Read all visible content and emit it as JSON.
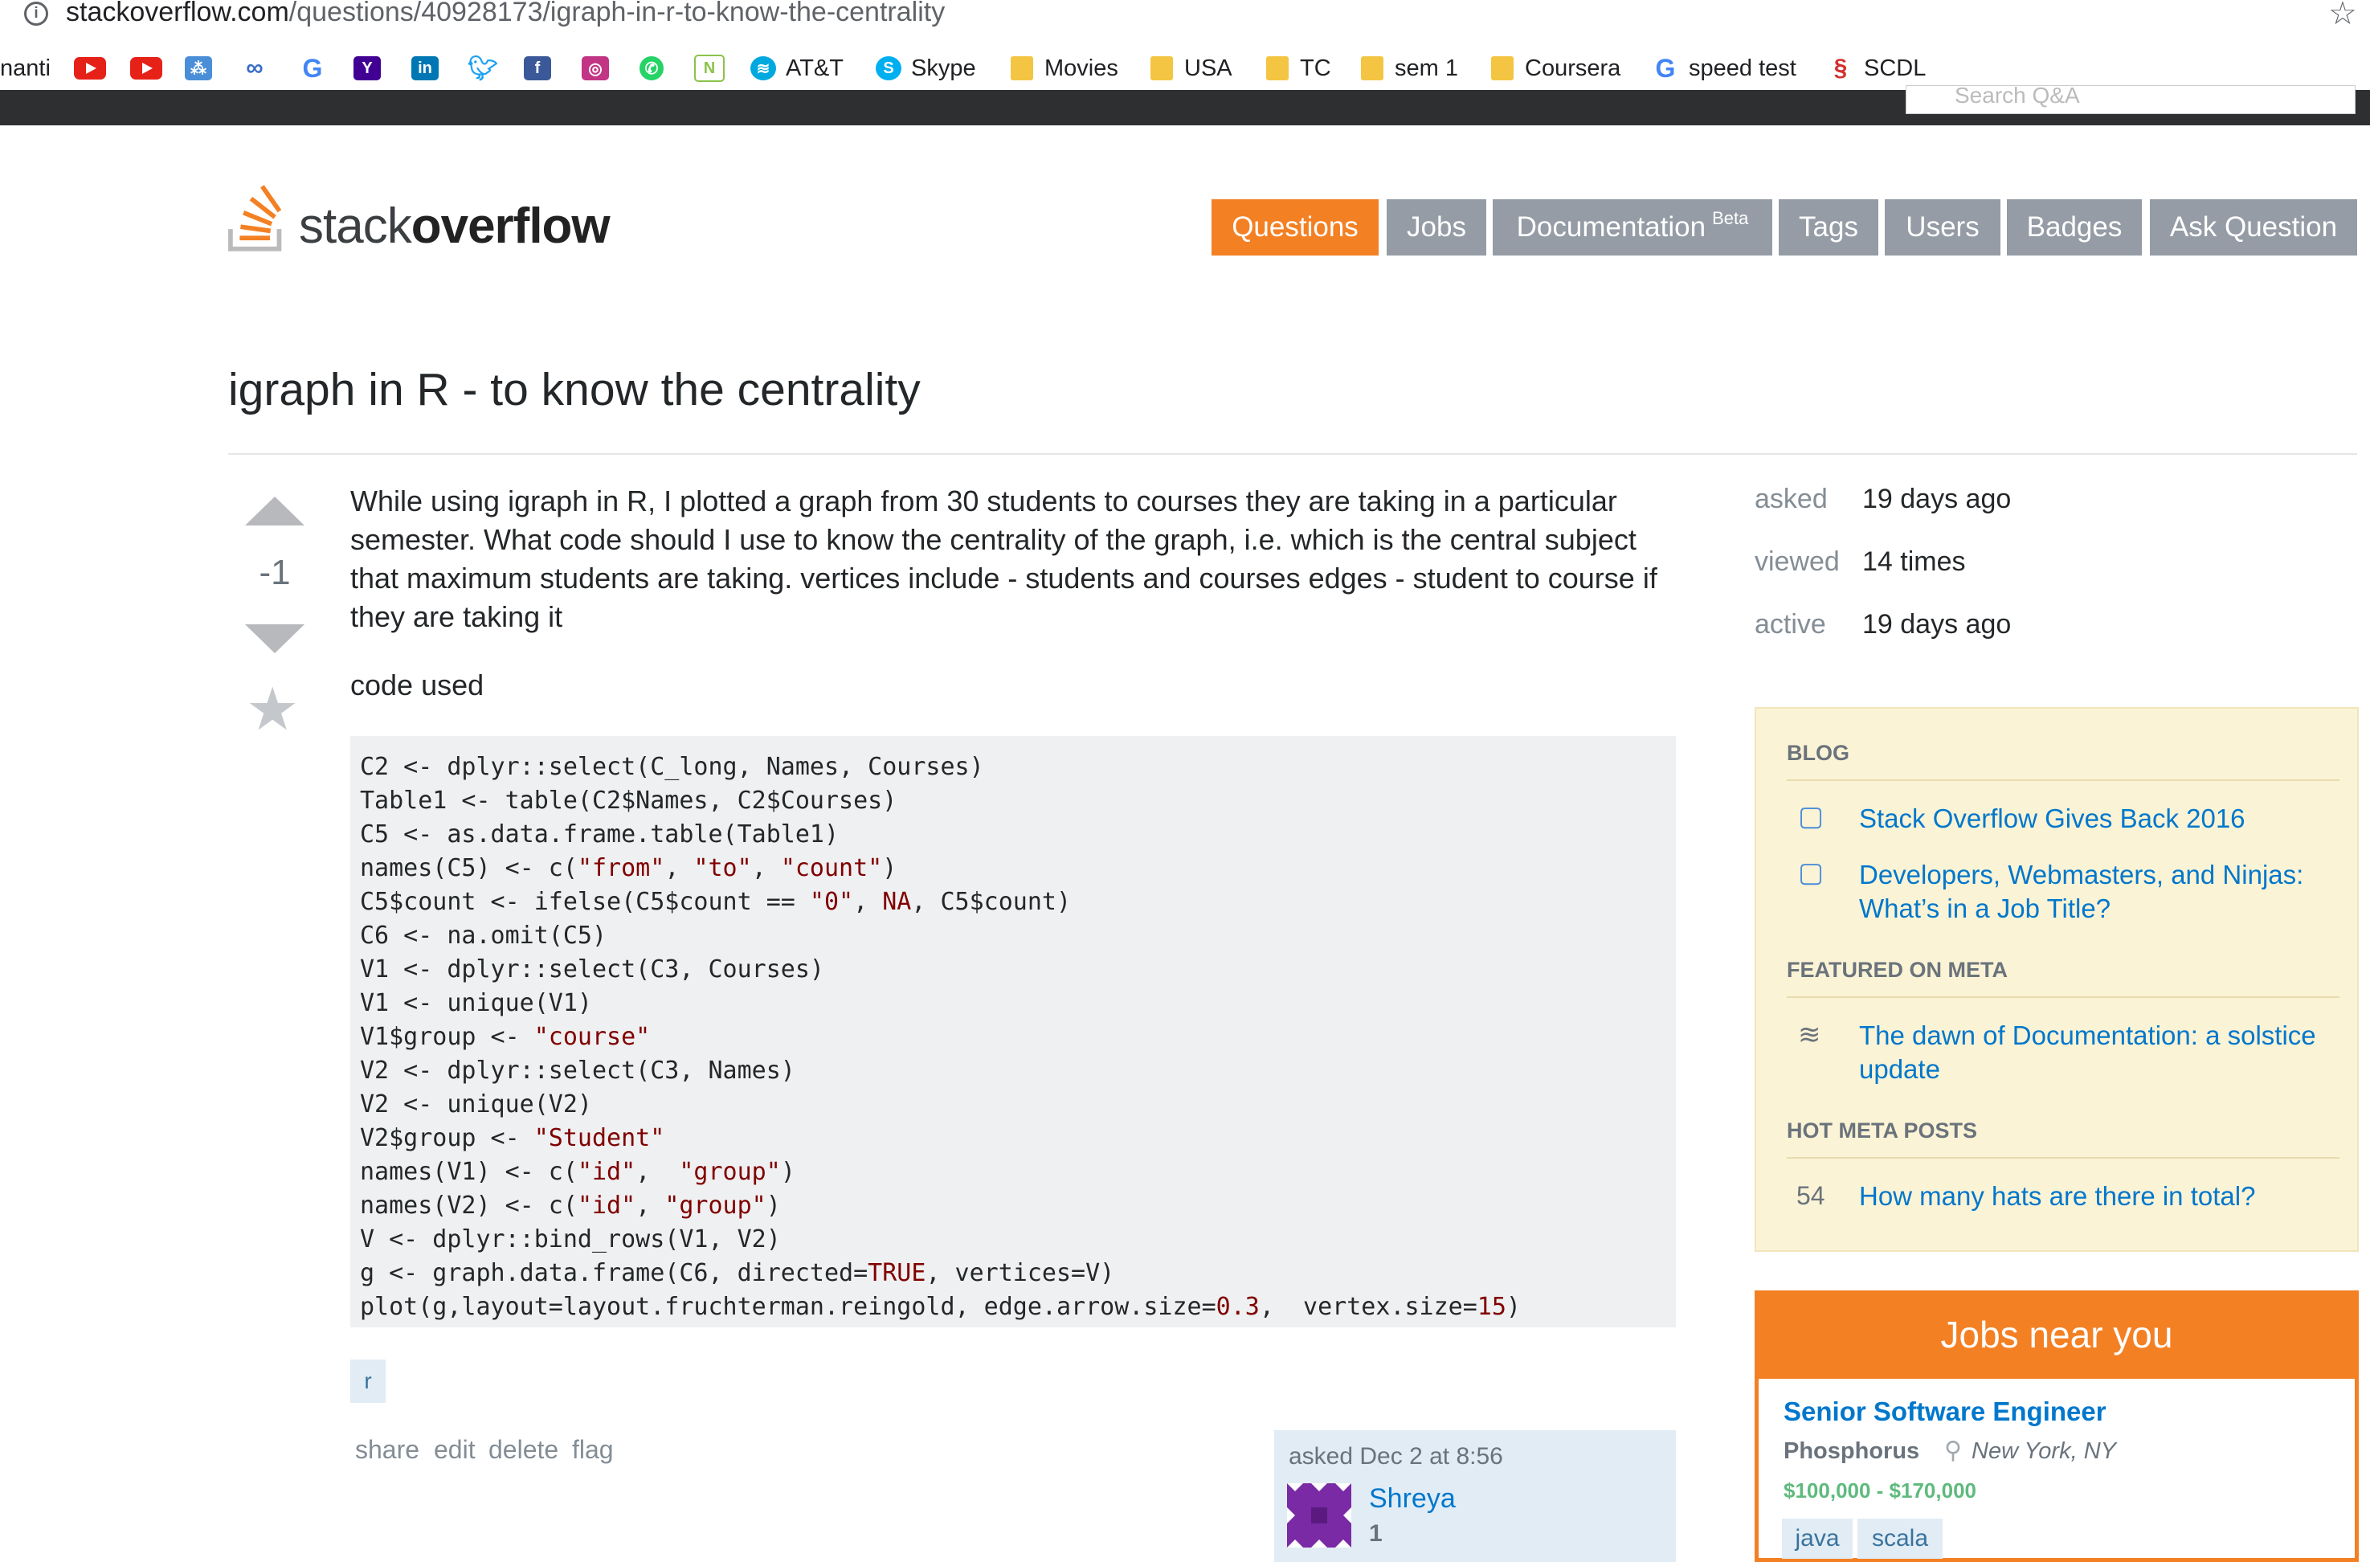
{
  "browser": {
    "url_host": "stackoverflow.com",
    "url_path": "/questions/40928173/igraph-in-r-to-know-the-centrality",
    "bookmarks": {
      "first_fragment": "nanti",
      "att": "AT&T",
      "skype": "Skype",
      "movies": "Movies",
      "usa": "USA",
      "tc": "TC",
      "sem1": "sem 1",
      "coursera": "Coursera",
      "speedtest": "speed test",
      "scdl": "SCDL"
    }
  },
  "topbar": {
    "search_placeholder": "Search Q&A"
  },
  "header": {
    "logo_light": "stack",
    "logo_bold": "overflow",
    "nav": {
      "questions": "Questions",
      "jobs": "Jobs",
      "documentation": "Documentation",
      "documentation_badge": "Beta",
      "tags": "Tags",
      "users": "Users",
      "badges": "Badges",
      "ask": "Ask Question"
    }
  },
  "question": {
    "title": "igraph in R - to know the centrality",
    "votes": "-1",
    "body": "While using igraph in R, I plotted a graph from 30 students to courses they are taking in a particular semester. What code should I use to know the centrality of the graph, i.e. which is the central subject that maximum students are taking. vertices include - students and courses edges - student to course if they are taking it",
    "code_intro": "code used",
    "code_lines": [
      [
        {
          "t": "C2 <- dplyr::select(C_long, Names, Courses)"
        }
      ],
      [
        {
          "t": "Table1 <- table(C2$Names, C2$Courses)"
        }
      ],
      [
        {
          "t": "C5 <- as.data.frame.table(Table1)"
        }
      ],
      [
        {
          "t": "names(C5) <- c("
        },
        {
          "t": "\"from\"",
          "s": 1
        },
        {
          "t": ", "
        },
        {
          "t": "\"to\"",
          "s": 1
        },
        {
          "t": ", "
        },
        {
          "t": "\"count\"",
          "s": 1
        },
        {
          "t": ")"
        }
      ],
      [
        {
          "t": "C5$count <- ifelse(C5$count == "
        },
        {
          "t": "\"0\"",
          "s": 1
        },
        {
          "t": ", "
        },
        {
          "t": "NA",
          "s": 1
        },
        {
          "t": ", C5$count)"
        }
      ],
      [
        {
          "t": "C6 <- na.omit(C5)"
        }
      ],
      [
        {
          "t": "V1 <- dplyr::select(C3, Courses)"
        }
      ],
      [
        {
          "t": "V1 <- unique(V1)"
        }
      ],
      [
        {
          "t": "V1$group <- "
        },
        {
          "t": "\"course\"",
          "s": 1
        }
      ],
      [
        {
          "t": "V2 <- dplyr::select(C3, Names)"
        }
      ],
      [
        {
          "t": "V2 <- unique(V2)"
        }
      ],
      [
        {
          "t": "V2$group <- "
        },
        {
          "t": "\"Student\"",
          "s": 1
        }
      ],
      [
        {
          "t": "names(V1) <- c("
        },
        {
          "t": "\"id\"",
          "s": 1
        },
        {
          "t": ",  "
        },
        {
          "t": "\"group\"",
          "s": 1
        },
        {
          "t": ")"
        }
      ],
      [
        {
          "t": "names(V2) <- c("
        },
        {
          "t": "\"id\"",
          "s": 1
        },
        {
          "t": ", "
        },
        {
          "t": "\"group\"",
          "s": 1
        },
        {
          "t": ")"
        }
      ],
      [
        {
          "t": "V <- dplyr::bind_rows(V1, V2)"
        }
      ],
      [
        {
          "t": "g <- graph.data.frame(C6, directed="
        },
        {
          "t": "TRUE",
          "s": 1
        },
        {
          "t": ", vertices=V)"
        }
      ],
      [
        {
          "t": "plot(g,layout=layout.fruchterman.reingold, edge.arrow.size="
        },
        {
          "t": "0.3",
          "s": 1
        },
        {
          "t": ",  vertex.size="
        },
        {
          "t": "15",
          "s": 1
        },
        {
          "t": ")"
        }
      ]
    ],
    "tag": "r",
    "menu": {
      "share": "share",
      "edit": "edit",
      "delete": "delete",
      "flag": "flag"
    },
    "owner": {
      "asked": "asked Dec 2 at 8:56",
      "name": "Shreya",
      "rep": "1"
    }
  },
  "sidebar": {
    "stats": {
      "asked_label": "asked",
      "asked_value": "19 days ago",
      "viewed_label": "viewed",
      "viewed_value": "14 times",
      "active_label": "active",
      "active_value": "19 days ago"
    },
    "blog_heading": "BLOG",
    "blog_1": "Stack Overflow Gives Back 2016",
    "blog_2": "Developers, Webmasters, and Ninjas: What’s in a Job Title?",
    "meta_heading": "FEATURED ON META",
    "meta_1": "The dawn of Documentation: a solstice update",
    "hot_heading": "HOT META POSTS",
    "hot_count": "54",
    "hot_1": "How many hats are there in total?"
  },
  "jobs": {
    "heading": "Jobs near you",
    "title": "Senior Software Engineer",
    "company": "Phosphorus",
    "location": "New York, NY",
    "salary": "$100,000 - $170,000",
    "tags": [
      "java",
      "scala"
    ]
  },
  "colors": {
    "accent": "#f48024",
    "link": "#0077cc",
    "nav_gray": "#959ca5",
    "blog_bg": "#fbf3d5"
  }
}
